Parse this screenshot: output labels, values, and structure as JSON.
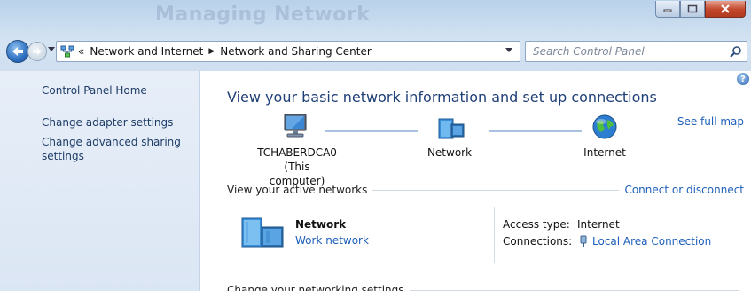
{
  "window": {
    "ghost_title": "Managing Network",
    "controls": {
      "minimize": "minimize",
      "maximize": "maximize",
      "close": "close"
    }
  },
  "nav": {
    "breadcrumb": [
      "Network and Internet",
      "Network and Sharing Center"
    ],
    "overflow_chevron": "«",
    "search_placeholder": "Search Control Panel"
  },
  "sidebar": {
    "items": [
      {
        "label": "Control Panel Home"
      },
      {
        "label": "Change adapter settings"
      },
      {
        "label": "Change advanced sharing settings"
      }
    ]
  },
  "main": {
    "title": "View your basic network information and set up connections",
    "help": "?",
    "map": {
      "computer_name": "TCHABERDCA0",
      "computer_note": "(This computer)",
      "network_label": "Network",
      "internet_label": "Internet",
      "see_full_map": "See full map"
    },
    "active_networks": {
      "heading": "View your active networks",
      "action": "Connect or disconnect",
      "network_name": "Network",
      "network_type": "Work network",
      "access_type_label": "Access type:",
      "access_type_value": "Internet",
      "connections_label": "Connections:",
      "connections_value": "Local Area Connection"
    },
    "settings_heading": "Change your networking settings"
  },
  "colors": {
    "link": "#1d5fb9",
    "title": "#1f3f77",
    "sidebar_bg": "#e7eef8"
  }
}
